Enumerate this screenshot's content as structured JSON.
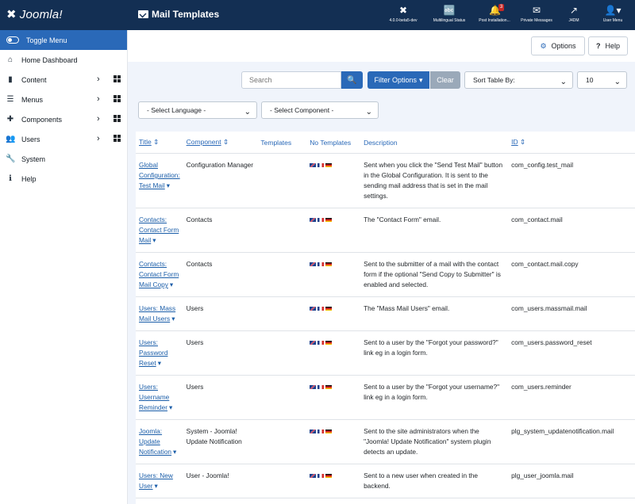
{
  "app": {
    "logo_text": "Joomla!"
  },
  "header": {
    "title": "Mail Templates",
    "items": [
      {
        "label": "4.0.0-beta5-dev",
        "icon": "joomla-icon"
      },
      {
        "label": "Multilingual Status",
        "icon": "language-icon"
      },
      {
        "label": "Post Installation...",
        "icon": "bell-icon",
        "badge": "3"
      },
      {
        "label": "Private Messages",
        "icon": "envelope-icon"
      },
      {
        "label": "J4DM",
        "icon": "external-link-icon"
      },
      {
        "label": "User Menu",
        "icon": "user-circle-icon"
      }
    ]
  },
  "sidebar": {
    "toggle_label": "Toggle Menu",
    "items": [
      {
        "label": "Home Dashboard",
        "icon": "home-icon"
      },
      {
        "label": "Content",
        "icon": "file-icon"
      },
      {
        "label": "Menus",
        "icon": "list-icon"
      },
      {
        "label": "Components",
        "icon": "puzzle-icon"
      },
      {
        "label": "Users",
        "icon": "users-icon"
      },
      {
        "label": "System",
        "icon": "wrench-icon"
      },
      {
        "label": "Help",
        "icon": "info-icon"
      }
    ]
  },
  "toolbar": {
    "options_label": "Options",
    "help_label": "Help"
  },
  "filters": {
    "search_placeholder": "Search",
    "filter_options_label": "Filter Options",
    "clear_label": "Clear",
    "sort_label": "Sort Table By:",
    "limit_value": "10",
    "language_select": "- Select Language -",
    "component_select": "- Select Component -"
  },
  "table": {
    "headers": {
      "title": "Title",
      "component": "Component",
      "templates": "Templates",
      "no_templates": "No Templates",
      "description": "Description",
      "id": "ID"
    },
    "rows": [
      {
        "title": "Global Configuration: Test Mail",
        "component": "Configuration Manager",
        "description": "Sent when you click the \"Send Test Mail\" button in the Global Configuration. It is sent to the sending mail address that is set in the mail settings.",
        "id": "com_config.test_mail"
      },
      {
        "title": "Contacts: Contact Form Mail",
        "component": "Contacts",
        "description": "The \"Contact Form\" email.",
        "id": "com_contact.mail"
      },
      {
        "title": "Contacts: Contact Form Mail Copy",
        "component": "Contacts",
        "description": "Sent to the submitter of a mail with the contact form if the optional \"Send Copy to Submitter\" is enabled and selected.",
        "id": "com_contact.mail.copy"
      },
      {
        "title": "Users: Mass Mail Users",
        "component": "Users",
        "description": "The \"Mass Mail Users\" email.",
        "id": "com_users.massmail.mail"
      },
      {
        "title": "Users: Password Reset",
        "component": "Users",
        "description": "Sent to a user by the \"Forgot your password?\" link eg in a login form.",
        "id": "com_users.password_reset"
      },
      {
        "title": "Users: Username Reminder",
        "component": "Users",
        "description": "Sent to a user by the \"Forgot your username?\" link eg in a login form.",
        "id": "com_users.reminder"
      },
      {
        "title": "Joomla: Update Notification",
        "component": "System - Joomla! Update Notification",
        "description": "Sent to the site administrators when the \"Joomla! Update Notification\" system plugin detects an update.",
        "id": "plg_system_updatenotification.mail"
      },
      {
        "title": "Users: New User",
        "component": "User - Joomla!",
        "description": "Sent to a new user when created in the backend.",
        "id": "plg_user_joomla.mail"
      }
    ]
  }
}
